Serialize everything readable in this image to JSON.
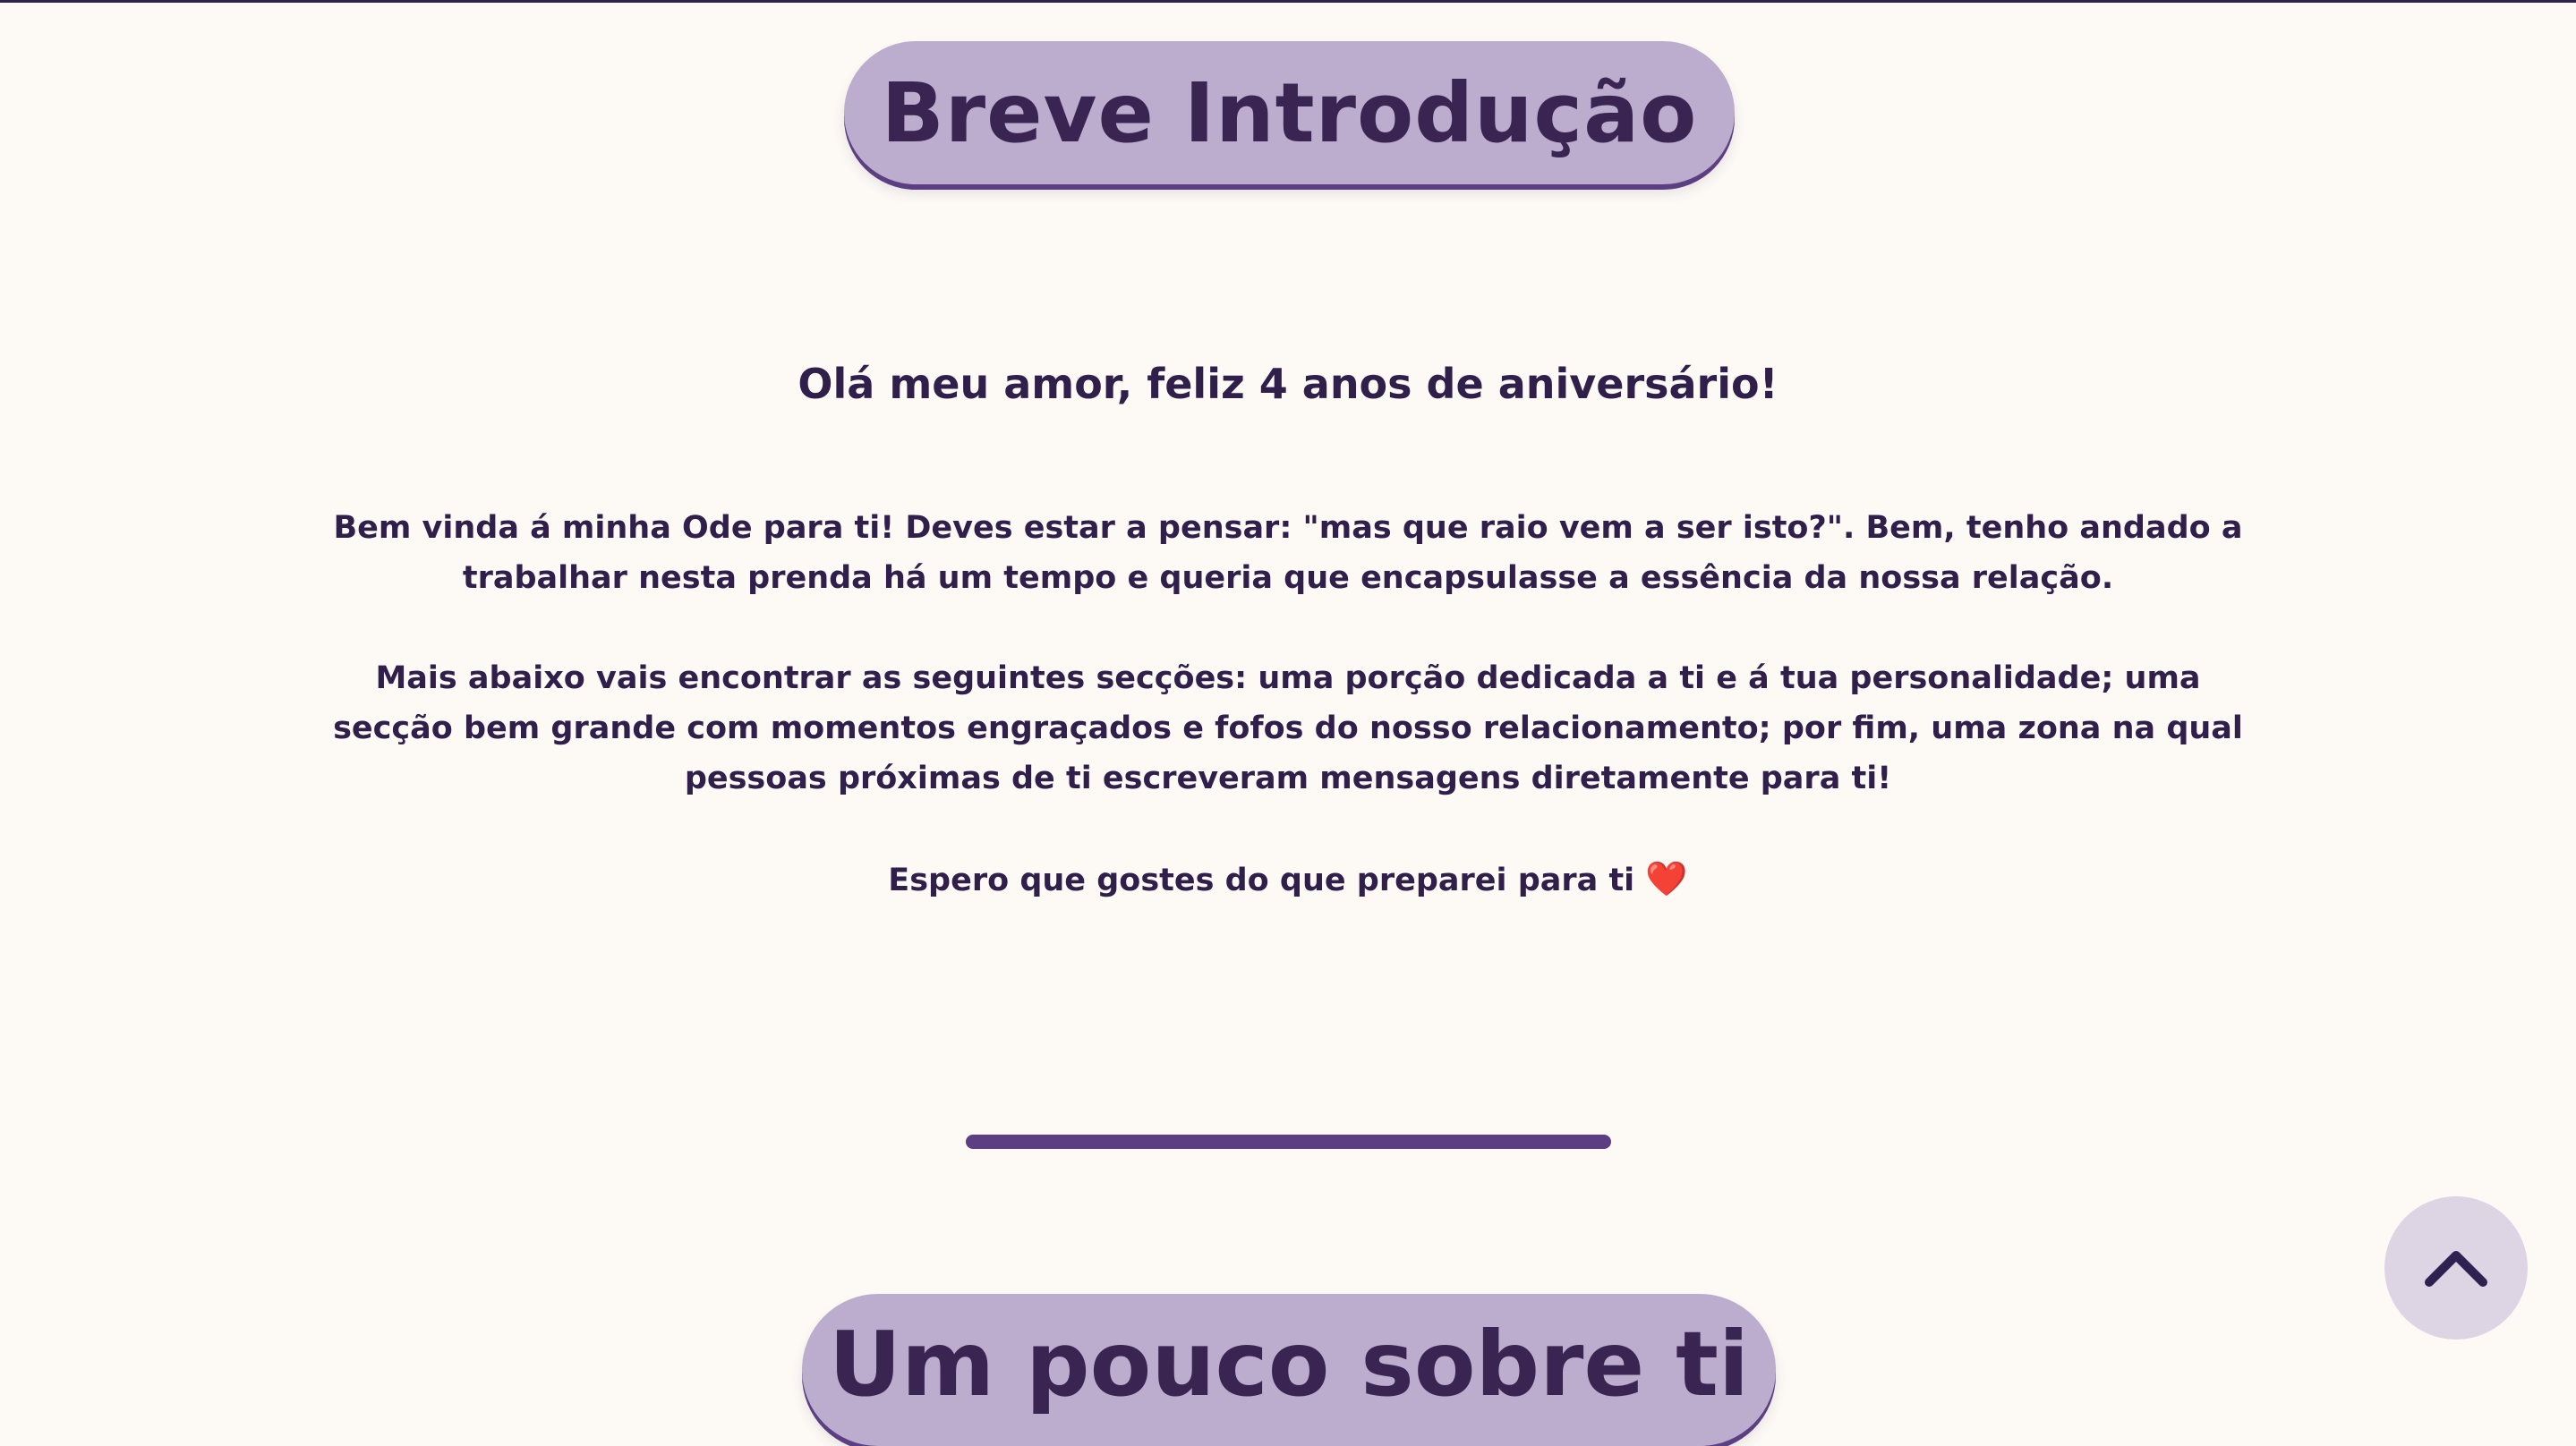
{
  "intro": {
    "title": "Breve Introdução",
    "greeting": "Olá meu amor, feliz 4 anos de aniversário!",
    "paragraph1": "Bem vinda á minha Ode para ti! Deves estar a pensar: \"mas que raio vem a ser isto?\". Bem, tenho andado a trabalhar nesta prenda há um tempo e queria que encapsulasse a essência da nossa relação.",
    "paragraph2": "Mais abaixo vais encontrar as seguintes secções: uma porção dedicada a ti e á tua personalidade; uma secção bem grande com momentos engraçados e fofos do nosso relacionamento; por fim, uma zona na qual pessoas próximas de ti escreveram mensagens diretamente para ti!",
    "closing": "Espero que gostes do que preparei para ti",
    "closing_emoji": "❤️"
  },
  "next_section": {
    "title": "Um pouco sobre ti"
  },
  "scroll_top": {
    "icon": "chevron-up-icon"
  },
  "colors": {
    "background": "#fdfaf5",
    "text": "#2f1f4a",
    "pill": "#bcaccd",
    "accent": "#5b3f82",
    "heart": "#e02424",
    "button": "#ddd4e4"
  }
}
